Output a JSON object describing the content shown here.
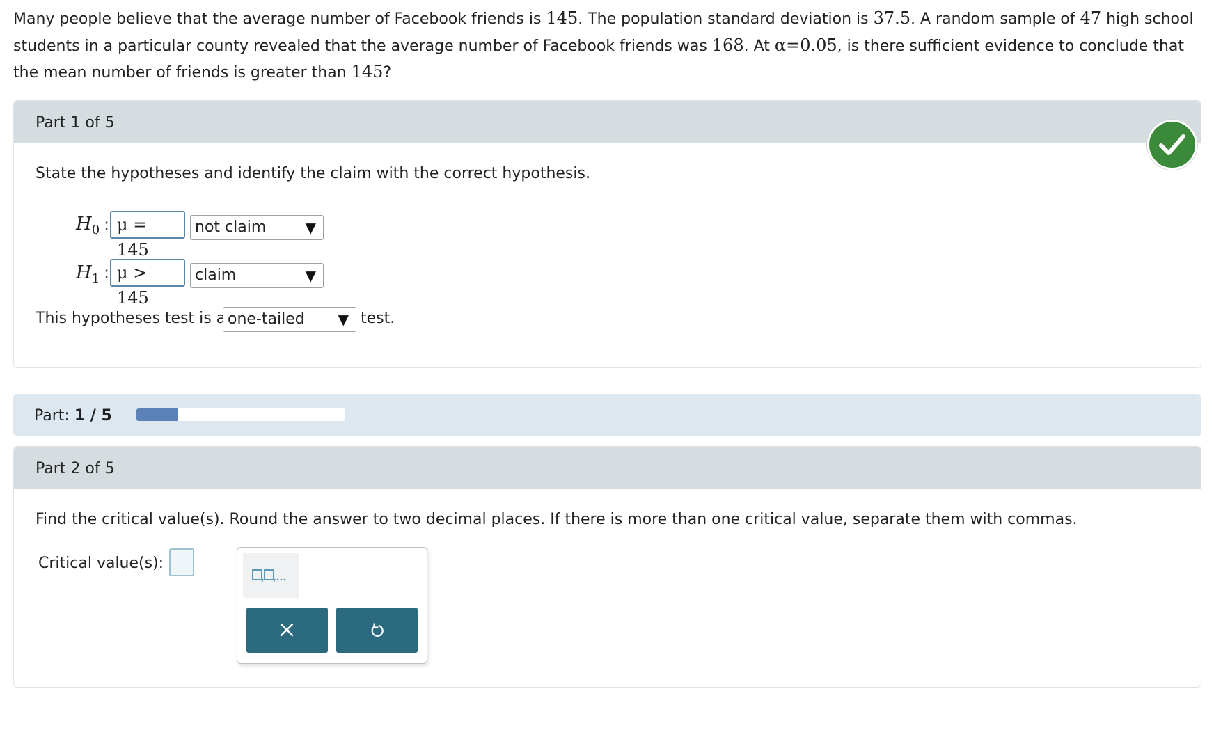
{
  "problem": {
    "t1": "Many people believe that the average number of Facebook friends is ",
    "n1": "145",
    "t2": ". The population standard deviation is ",
    "n2": "37.5",
    "t3": ". A random sample of ",
    "n3": "47",
    "t4": " high school students in a particular county revealed that the average number of Facebook friends was ",
    "n4": "168",
    "t5": ". At ",
    "n5": "α=0.05",
    "t6": ", is there sufficient evidence to conclude that the mean number of friends is greater than ",
    "n6": "145",
    "t7": "?"
  },
  "part1": {
    "title": "Part 1 of 5",
    "status_icon": "check-circle-icon",
    "status_color": "#3a8a3a",
    "instruction": "State the hypotheses and identify the claim with the correct hypothesis.",
    "h0": {
      "label": "H",
      "sub": "0",
      "colon": ":",
      "expression": "μ = 145",
      "claim_select": "not claim"
    },
    "h1": {
      "label": "H",
      "sub": "1",
      "colon": ":",
      "expression": "μ > 145",
      "claim_select": "claim"
    },
    "test_prefix": "This hypotheses test is a",
    "test_select": "one-tailed",
    "test_suffix": "test.",
    "dropdown_arrow": "▼"
  },
  "progress": {
    "label": "Part:",
    "value": "1 / 5",
    "fraction": 0.2,
    "fill_color": "#5a82b6"
  },
  "part2": {
    "title": "Part 2 of 5",
    "instruction": "Find the critical value(s). Round the answer to two decimal places. If there is more than one critical value, separate them with commas.",
    "answer_label": "Critical value(s):",
    "answer_value": "",
    "keypad": {
      "template_icon": "list-template-icon",
      "clear_icon": "close-icon",
      "undo_icon": "undo-icon",
      "button_color": "#2c6a80"
    }
  }
}
